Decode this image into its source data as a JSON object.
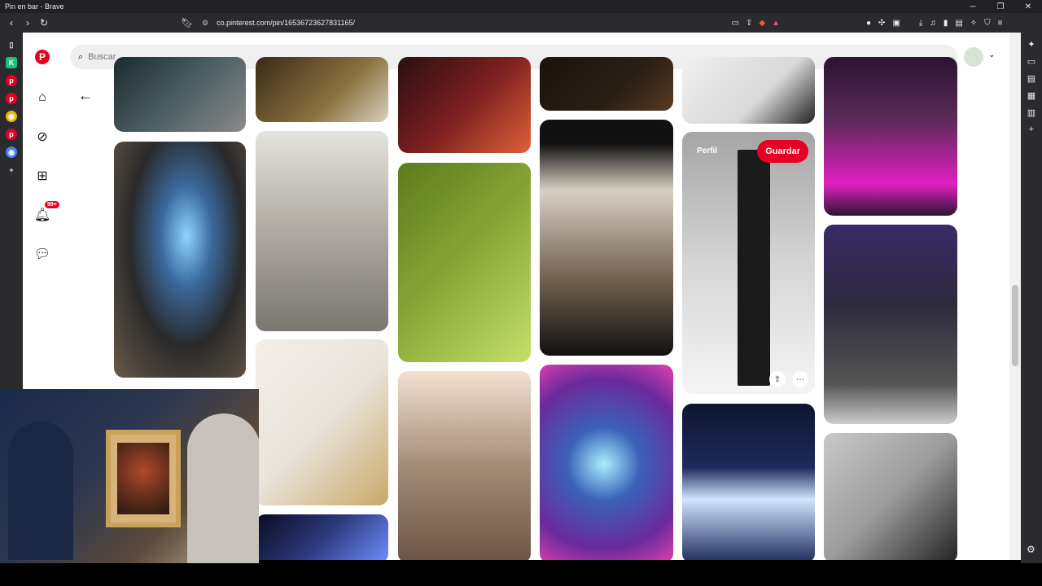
{
  "browser": {
    "title": "Pin en bar - Brave",
    "url": "co.pinterest.com/pin/16536723627831165/",
    "window_controls": [
      "─",
      "❐",
      "✕"
    ]
  },
  "search": {
    "placeholder": "Buscar"
  },
  "notifications": {
    "badge": "99+"
  },
  "pin_hover": {
    "perfil_label": "Perfil",
    "save_label": "Guardar"
  },
  "pins": [
    {
      "name": "neon-floor-tile",
      "color": "#4b5d63"
    },
    {
      "name": "tech-logo-wall",
      "color": "#555"
    },
    {
      "name": "floating-sneaker-display",
      "color": "#3a6a9e"
    },
    {
      "name": "gold-wall-shelf",
      "color": "#8a7340"
    },
    {
      "name": "sneaker-store-shelves",
      "color": "#b9b5ad"
    },
    {
      "name": "toilet-paper-tictactoe",
      "color": "#e9e4dc"
    },
    {
      "name": "infinity-mirror-table",
      "color": "#2c3a7d"
    },
    {
      "name": "red-led-shelves",
      "color": "#7b1f1f"
    },
    {
      "name": "green-led-wall-shelves",
      "color": "#8aa838"
    },
    {
      "name": "triangle-shelf-desk",
      "color": "#a38b76"
    },
    {
      "name": "dark-shelf-top",
      "color": "#2a1f15"
    },
    {
      "name": "wood-light-dining-room",
      "color": "#6b5b4a"
    },
    {
      "name": "neon-cloud-bathroom",
      "color": "#3a63b8"
    },
    {
      "name": "car-brand-shelf",
      "color": "#d8d8d8"
    },
    {
      "name": "black-ladder-shelf",
      "color": "#d5d5d5"
    },
    {
      "name": "corona-bar-shelves",
      "color": "#1d2a5c"
    },
    {
      "name": "purple-rooftop-bar",
      "color": "#5d2a5a"
    },
    {
      "name": "purple-gaming-room",
      "color": "#2e2a3c"
    },
    {
      "name": "hand-shaped-shelves",
      "color": "#9c9c9c"
    }
  ],
  "colors": {
    "pinterest_red": "#e60023",
    "brave_orange": "#fb542b"
  }
}
